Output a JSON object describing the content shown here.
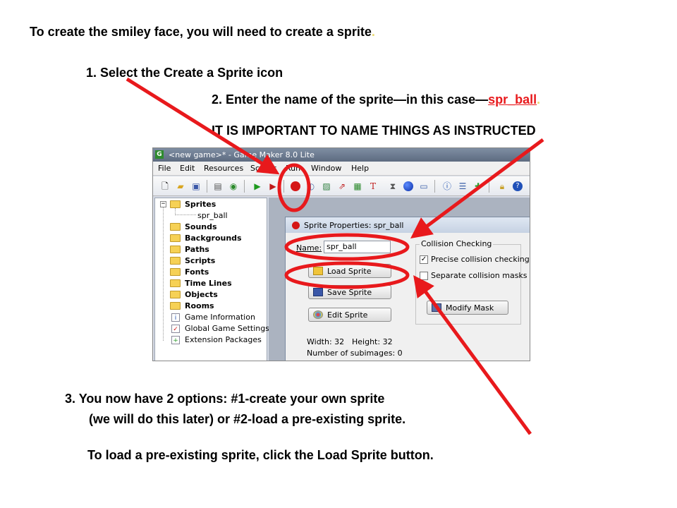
{
  "instructions": {
    "heading": "To create the smiley face, you will need to create a sprite",
    "heading_dot": ".",
    "step1": "1.   Select the Create a Sprite icon",
    "step2_prefix": "2.   Enter the name of the sprite—in this case—",
    "step2_name": "spr_ball",
    "step2_dot": ".",
    "important": "IT IS IMPORTANT TO NAME THINGS AS INSTRUCTED",
    "step3_line1": "3.   You now have 2 options: #1-create your own sprite",
    "step3_line2": "(we will do this later) or  #2-load a pre-existing sprite.",
    "load_note": "To load a pre-existing sprite, click the Load Sprite button."
  },
  "app": {
    "app_icon": "G",
    "title": "<new game>* - Game Maker 8.0 Lite",
    "menu": [
      "File",
      "Edit",
      "Resources",
      "Scripts",
      "Run",
      "Window",
      "Help"
    ],
    "toolbar_icons": [
      "new-icon",
      "open-icon",
      "save-icon",
      "create-executable-icon",
      "publish-icon",
      "run-icon",
      "debug-icon",
      "create-sprite-icon",
      "create-sound-icon",
      "create-background-icon",
      "create-path-icon",
      "create-script-icon",
      "create-font-icon",
      "create-timeline-icon",
      "create-object-icon",
      "create-room-icon",
      "game-info-icon",
      "global-settings-icon",
      "extension-icon",
      "upgrade-icon",
      "help-icon"
    ],
    "tree": {
      "sprites": "Sprites",
      "sprite_child": "spr_ball",
      "sounds": "Sounds",
      "backgrounds": "Backgrounds",
      "paths": "Paths",
      "scripts": "Scripts",
      "fonts": "Fonts",
      "time_lines": "Time Lines",
      "objects": "Objects",
      "rooms": "Rooms",
      "game_information": "Game Information",
      "global_game_settings": "Global Game Settings",
      "extension_packages": "Extension Packages"
    },
    "sprite_window": {
      "title": "Sprite Properties: spr_ball",
      "name_label": "Name:",
      "name_value": "spr_ball",
      "load_sprite": "Load Sprite",
      "save_sprite": "Save Sprite",
      "edit_sprite": "Edit Sprite",
      "width_text": "Width: 32",
      "height_text": "Height: 32",
      "subimages_text": "Number of subimages: 0",
      "collision_group": "Collision Checking",
      "precise_label": "Precise collision checking",
      "precise_checked": true,
      "separate_label": "Separate collision masks",
      "separate_checked": false,
      "modify_mask": "Modify Mask"
    }
  },
  "colors": {
    "annotation_red": "#e8191c",
    "titlebar": "#6b7a90"
  }
}
